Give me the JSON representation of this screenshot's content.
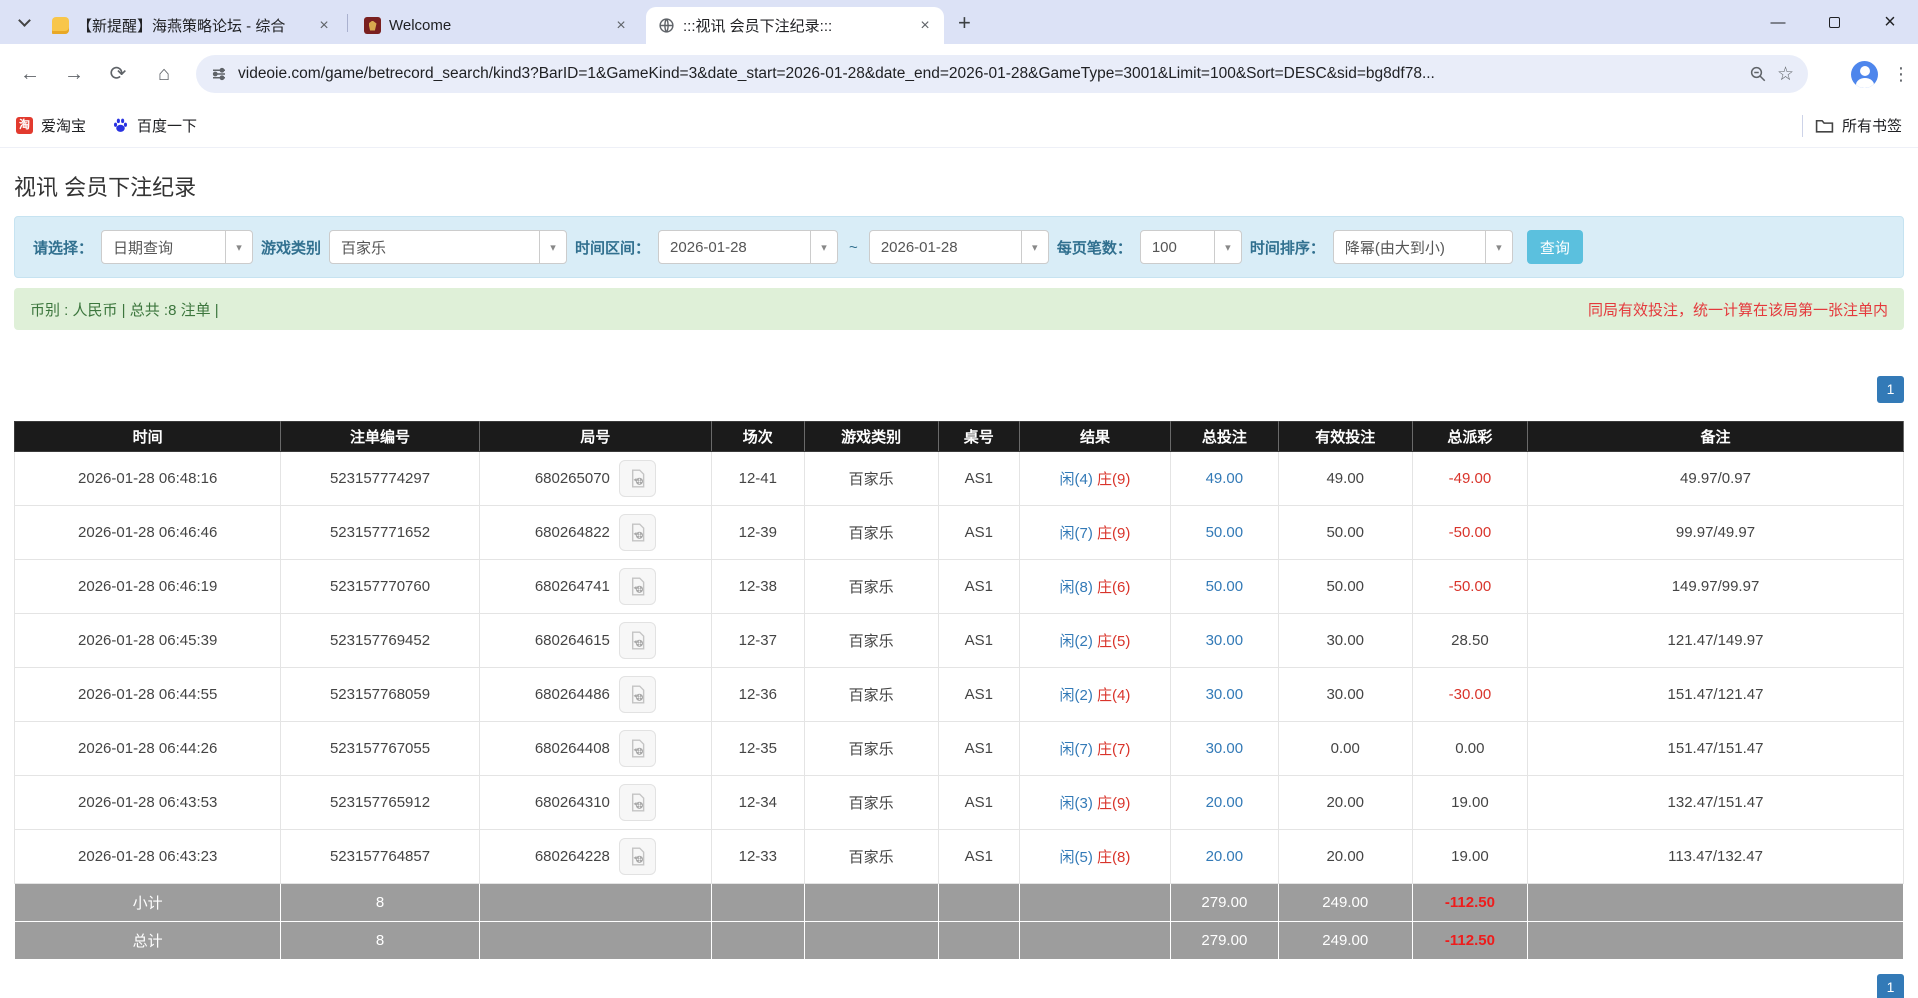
{
  "icons": {
    "back": "←",
    "forward": "→",
    "reload": "⟳",
    "home": "⌂",
    "close": "×",
    "minimize": "—",
    "new_tab": "+",
    "caret": "▾",
    "menu": "⋮",
    "star": "☆",
    "taobao_glyph": "淘"
  },
  "browser": {
    "tabs": [
      {
        "title": "【新提醒】海燕策略论坛 - 综合",
        "favicon": "yellow-chat-bubble",
        "active": false
      },
      {
        "title": "Welcome",
        "favicon": "dark-red-crest",
        "active": false
      },
      {
        "title": ":::视讯 会员下注纪录:::",
        "favicon": "globe",
        "active": true
      }
    ],
    "url": "videoie.com/game/betrecord_search/kind3?BarID=1&GameKind=3&date_start=2026-01-28&date_end=2026-01-28&GameType=3001&Limit=100&Sort=DESC&sid=bg8df78...",
    "bookmarks": [
      {
        "label": "爱淘宝"
      },
      {
        "label": "百度一下"
      }
    ],
    "all_bookmarks_label": "所有书签"
  },
  "page": {
    "title": "视讯 会员下注纪录",
    "filters": {
      "select_label": "请选择：",
      "select_value": "日期查询",
      "category_label": "游戏类别",
      "category_value": "百家乐",
      "range_label": "时间区间：",
      "date_from": "2026-01-28",
      "tilde": "~",
      "date_to": "2026-01-28",
      "page_size_label": "每页笔数：",
      "page_size_value": "100",
      "sort_label": "时间排序：",
      "sort_value": "降幂(由大到小)",
      "search_button": "查询"
    },
    "info_bar": {
      "left": "币别 : 人民币 | 总共 :8 注单 |",
      "right": "同局有效投注，统一计算在该局第一张注单内"
    },
    "pagination": {
      "current": "1"
    },
    "table": {
      "headers": [
        "时间",
        "注单编号",
        "局号",
        "场次",
        "游戏类别",
        "桌号",
        "结果",
        "总投注",
        "有效投注",
        "总派彩",
        "备注"
      ],
      "col_widths": [
        "14.1%",
        "10.5%",
        "12.3%",
        "4.9%",
        "7.1%",
        "4.3%",
        "8.0%",
        "5.7%",
        "7.1%",
        "6.1%",
        "19.9%"
      ],
      "rows": [
        {
          "time": "2026-01-28 06:48:16",
          "bet_id": "523157774297",
          "round": "680265070",
          "session": "12-41",
          "game": "百家乐",
          "table": "AS1",
          "result_player": "闲(4)",
          "result_banker": "庄(9)",
          "total_bet": "49.00",
          "valid_bet": "49.00",
          "payout": "-49.00",
          "remark": "49.97/0.97"
        },
        {
          "time": "2026-01-28 06:46:46",
          "bet_id": "523157771652",
          "round": "680264822",
          "session": "12-39",
          "game": "百家乐",
          "table": "AS1",
          "result_player": "闲(7)",
          "result_banker": "庄(9)",
          "total_bet": "50.00",
          "valid_bet": "50.00",
          "payout": "-50.00",
          "remark": "99.97/49.97"
        },
        {
          "time": "2026-01-28 06:46:19",
          "bet_id": "523157770760",
          "round": "680264741",
          "session": "12-38",
          "game": "百家乐",
          "table": "AS1",
          "result_player": "闲(8)",
          "result_banker": "庄(6)",
          "total_bet": "50.00",
          "valid_bet": "50.00",
          "payout": "-50.00",
          "remark": "149.97/99.97"
        },
        {
          "time": "2026-01-28 06:45:39",
          "bet_id": "523157769452",
          "round": "680264615",
          "session": "12-37",
          "game": "百家乐",
          "table": "AS1",
          "result_player": "闲(2)",
          "result_banker": "庄(5)",
          "total_bet": "30.00",
          "valid_bet": "30.00",
          "payout": "28.50",
          "remark": "121.47/149.97"
        },
        {
          "time": "2026-01-28 06:44:55",
          "bet_id": "523157768059",
          "round": "680264486",
          "session": "12-36",
          "game": "百家乐",
          "table": "AS1",
          "result_player": "闲(2)",
          "result_banker": "庄(4)",
          "total_bet": "30.00",
          "valid_bet": "30.00",
          "payout": "-30.00",
          "remark": "151.47/121.47"
        },
        {
          "time": "2026-01-28 06:44:26",
          "bet_id": "523157767055",
          "round": "680264408",
          "session": "12-35",
          "game": "百家乐",
          "table": "AS1",
          "result_player": "闲(7)",
          "result_banker": "庄(7)",
          "total_bet": "30.00",
          "valid_bet": "0.00",
          "payout": "0.00",
          "remark": "151.47/151.47"
        },
        {
          "time": "2026-01-28 06:43:53",
          "bet_id": "523157765912",
          "round": "680264310",
          "session": "12-34",
          "game": "百家乐",
          "table": "AS1",
          "result_player": "闲(3)",
          "result_banker": "庄(9)",
          "total_bet": "20.00",
          "valid_bet": "20.00",
          "payout": "19.00",
          "remark": "132.47/151.47"
        },
        {
          "time": "2026-01-28 06:43:23",
          "bet_id": "523157764857",
          "round": "680264228",
          "session": "12-33",
          "game": "百家乐",
          "table": "AS1",
          "result_player": "闲(5)",
          "result_banker": "庄(8)",
          "total_bet": "20.00",
          "valid_bet": "20.00",
          "payout": "19.00",
          "remark": "113.47/132.47"
        }
      ],
      "footer": [
        {
          "label": "小计",
          "count": "8",
          "total_bet": "279.00",
          "valid_bet": "249.00",
          "payout": "-112.50"
        },
        {
          "label": "总计",
          "count": "8",
          "total_bet": "279.00",
          "valid_bet": "249.00",
          "payout": "-112.50"
        }
      ]
    },
    "colors": {
      "accent_blue": "#337ab7",
      "result_player_blue": "#337ab7",
      "result_banker_red": "#d9342b",
      "negative_red": "#d9342b",
      "filter_bg": "#d9edf7",
      "info_bg": "#dff0d8",
      "header_bg": "#1b1b1b",
      "footer_bg": "#9d9d9d",
      "search_btn": "#5bc0de"
    }
  }
}
